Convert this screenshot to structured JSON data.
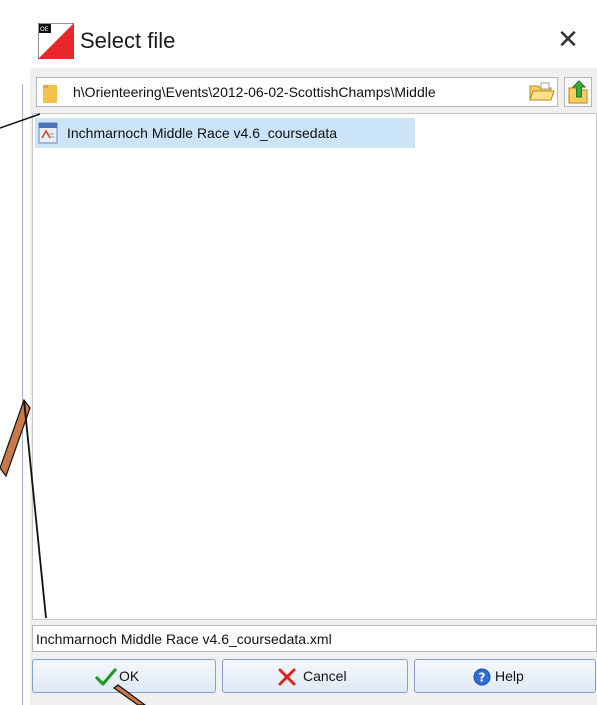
{
  "window": {
    "title": "Select file",
    "close_glyph": "✕",
    "app_icon": "oe-app-icon"
  },
  "path_bar": {
    "path": "h\\Orienteering\\Events\\2012-06-02-ScottishChamps\\Middle",
    "folder_icon": "folder-icon",
    "browse_icon": "open-folder-icon",
    "up_icon": "up-folder-icon"
  },
  "file_list": {
    "items": [
      {
        "label": "Inchmarnoch Middle Race v4.6_coursedata",
        "icon": "xml-file-icon",
        "selected": true
      }
    ]
  },
  "filename_field": {
    "value": "Inchmarnoch Middle Race v4.6_coursedata.xml"
  },
  "buttons": {
    "ok": "OK",
    "cancel": "Cancel",
    "help": "Help"
  },
  "colors": {
    "selection": "#cce4f7",
    "button_border": "#7fa2c8",
    "callout_fill": "#c8784a"
  }
}
